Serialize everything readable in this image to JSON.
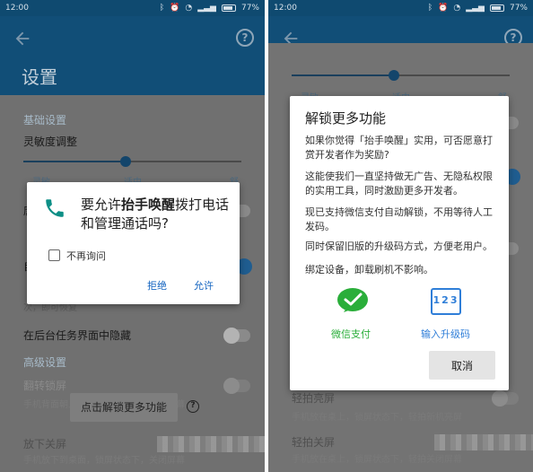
{
  "left": {
    "status": {
      "time": "12:00",
      "battery": "77%"
    },
    "page_title": "设置",
    "settings": {
      "basic_header": "基础设置",
      "sensitivity": "灵敏度调整",
      "sensitivity_level": 0.47,
      "slider_labels": [
        "灵敏",
        "适中",
        "舒"
      ],
      "row_a": "唐",
      "row_b": "自",
      "row_c_sub": "次，即可恢复",
      "hide_recent": "在后台任务界面中隐藏",
      "advanced_header": "高级设置",
      "flip_lock": "翻转锁屏",
      "flip_lock_sub": "手机背面朝上，锁屏状态下，自动锁屏幕",
      "pocket_lock": "放下关屏",
      "pocket_lock_sub": "手机放下到桌面，锁屏状态下，关闭屏幕"
    },
    "unlock_button": "点击解锁更多功能",
    "permission_dialog": {
      "title_pre": "要允许",
      "app_name": "抬手唤醒",
      "title_post": "拨打电话和管理通话吗?",
      "dont_ask": "不再询问",
      "deny": "拒绝",
      "allow": "允许"
    }
  },
  "right": {
    "status": {
      "time": "12:00",
      "battery": "77%"
    },
    "slider_labels": [
      "灵敏",
      "适中",
      "舒"
    ],
    "sensitivity_level": 0.47,
    "rows": [
      "轻拍亮屏",
      "手机放在桌上，锁屏状态下，轻拍新机亮屏",
      "轻拍关屏",
      "手机放在桌上，锁屏状态下，轻拍关闭屏幕"
    ],
    "dialog": {
      "title": "解锁更多功能",
      "p1": "如果你觉得「抬手唤醒」实用，可否愿意打赏开发者作为奖励?",
      "p2": "这能使我们一直坚持做无广告、无隐私权限的实用工具，同时激励更多开发者。",
      "p3": "现已支持微信支付自动解锁，不用等待人工发码。",
      "p4": "同时保留旧版的升级码方式，方便老用户。",
      "p5": "绑定设备，卸载刷机不影响。",
      "wechat_pay": "微信支付",
      "enter_code": "输入升级码",
      "code_icon_text": "123",
      "cancel": "取消"
    }
  },
  "colors": {
    "accent_blue": "#1565c0",
    "wechat_green": "#2aae3a",
    "code_blue": "#2f7ed8"
  }
}
